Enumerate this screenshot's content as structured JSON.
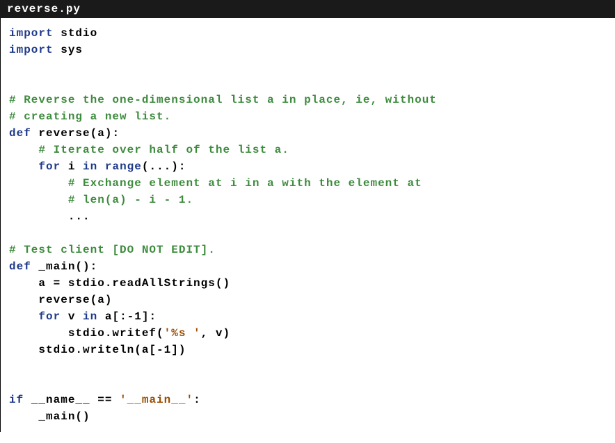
{
  "filename": "reverse.py",
  "code": {
    "import1_kw": "import",
    "import1_mod": "stdio",
    "import2_kw": "import",
    "import2_mod": "sys",
    "comment1": "# Reverse the one-dimensional list a in place, ie, without",
    "comment2": "# creating a new list.",
    "def1_kw": "def",
    "def1_name": "reverse(a):",
    "comment3": "# Iterate over half of the list a.",
    "for1_kw": "for",
    "for1_var": "i",
    "for1_in": "in",
    "for1_range": "range",
    "for1_rest": "(...):",
    "comment4": "# Exchange element at i in a with the element at",
    "comment5": "# len(a) - i - 1.",
    "ellipsis": "...",
    "comment6": "# Test client [DO NOT EDIT].",
    "def2_kw": "def",
    "def2_name": "_main():",
    "line_a": "a = stdio.readAllStrings()",
    "line_rev": "reverse(a)",
    "for2_kw": "for",
    "for2_var": "v",
    "for2_in": "in",
    "for2_rest": "a[:-1]:",
    "line_writef1": "stdio.writef(",
    "line_writef_fmt": "'%s '",
    "line_writef2": ", v)",
    "line_writeln": "stdio.writeln(a[-1])",
    "if_kw": "if",
    "if_name": "__name__ ==",
    "if_str": "'__main__'",
    "if_colon": ":",
    "call_main": "_main()"
  }
}
